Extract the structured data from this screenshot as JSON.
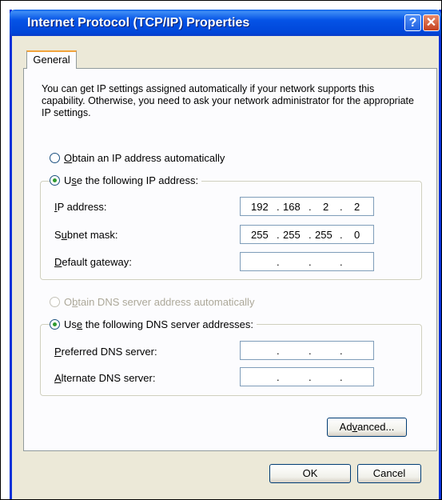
{
  "window": {
    "title": "Internet Protocol (TCP/IP) Properties",
    "help_glyph": "?",
    "close_glyph": "✕"
  },
  "tabs": [
    {
      "label": "General"
    }
  ],
  "description": "You can get IP settings assigned automatically if your network supports this capability. Otherwise, you need to ask your network administrator for the appropriate IP settings.",
  "ip_options": {
    "auto": {
      "u": "O",
      "rest": "btain an IP address automatically",
      "selected": false
    },
    "manual": {
      "pre": "U",
      "u": "s",
      "rest": "e the following IP address:",
      "selected": true
    }
  },
  "ip_fields": [
    {
      "u": "I",
      "rest": "P address:",
      "octets": [
        "192",
        "168",
        "2",
        "2"
      ]
    },
    {
      "pre": "S",
      "u": "u",
      "rest": "bnet mask:",
      "octets": [
        "255",
        "255",
        "255",
        "0"
      ]
    },
    {
      "u": "D",
      "rest": "efault gateway:",
      "octets": [
        "",
        "",
        "",
        ""
      ]
    }
  ],
  "dns_options": {
    "auto": {
      "pre": "O",
      "u": "b",
      "rest": "tain DNS server address automatically",
      "selected": false,
      "disabled": true
    },
    "manual": {
      "pre": "Us",
      "u": "e",
      "rest": " the following DNS server addresses:",
      "selected": true
    }
  },
  "dns_fields": [
    {
      "u": "P",
      "rest": "referred DNS server:",
      "octets": [
        "",
        "",
        "",
        ""
      ]
    },
    {
      "u": "A",
      "rest": "lternate DNS server:",
      "octets": [
        "",
        "",
        "",
        ""
      ]
    }
  ],
  "buttons": {
    "advanced": {
      "pre": "Ad",
      "u": "v",
      "rest": "anced..."
    },
    "ok": "OK",
    "cancel": "Cancel"
  },
  "dot": "."
}
